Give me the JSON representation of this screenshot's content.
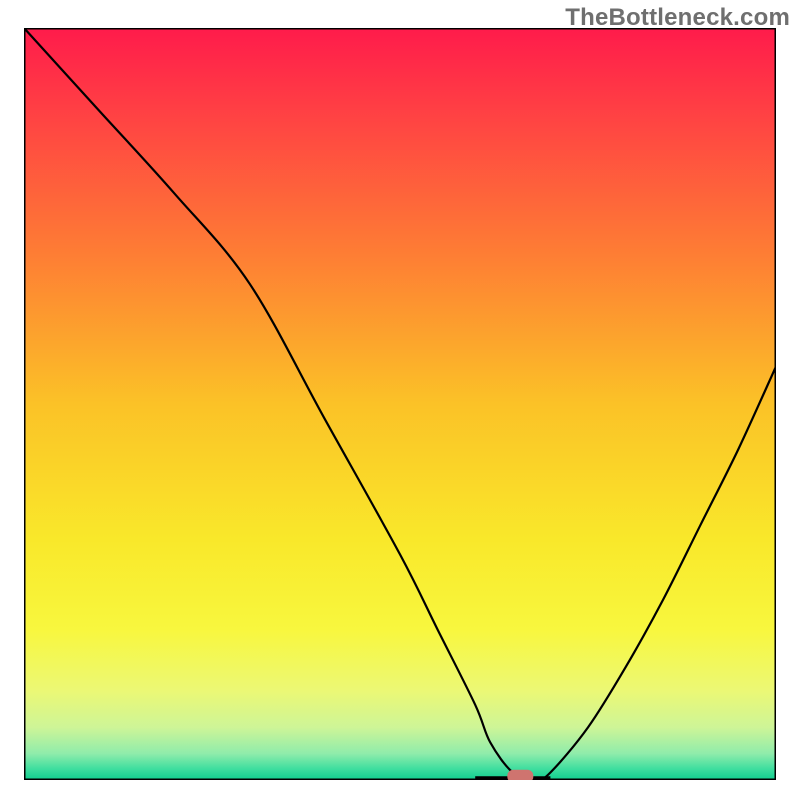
{
  "watermark": "TheBottleneck.com",
  "chart_data": {
    "type": "line",
    "title": "",
    "xlabel": "",
    "ylabel": "",
    "xlim": [
      0,
      100
    ],
    "ylim": [
      0,
      100
    ],
    "grid": false,
    "legend": false,
    "series": [
      {
        "name": "bottleneck-curve",
        "x": [
          0,
          10,
          20,
          30,
          40,
          50,
          55,
          60,
          62,
          65,
          68,
          70,
          75,
          80,
          85,
          90,
          95,
          100
        ],
        "values": [
          100,
          89,
          78,
          66,
          48,
          30,
          20,
          10,
          5,
          1,
          0,
          1,
          7,
          15,
          24,
          34,
          44,
          55
        ]
      }
    ],
    "marker": {
      "name": "optimal-point",
      "x": 66,
      "y": 0.5,
      "color": "#cf746f"
    },
    "background_gradient": {
      "stops": [
        {
          "offset": 0.0,
          "color": "#ff1b4b"
        },
        {
          "offset": 0.12,
          "color": "#ff4343"
        },
        {
          "offset": 0.3,
          "color": "#fe7d34"
        },
        {
          "offset": 0.5,
          "color": "#fbc227"
        },
        {
          "offset": 0.68,
          "color": "#f9e82a"
        },
        {
          "offset": 0.8,
          "color": "#f8f73e"
        },
        {
          "offset": 0.88,
          "color": "#ecf874"
        },
        {
          "offset": 0.93,
          "color": "#cef597"
        },
        {
          "offset": 0.965,
          "color": "#8fecab"
        },
        {
          "offset": 0.985,
          "color": "#3fde9f"
        },
        {
          "offset": 1.0,
          "color": "#0fce8e"
        }
      ]
    }
  }
}
